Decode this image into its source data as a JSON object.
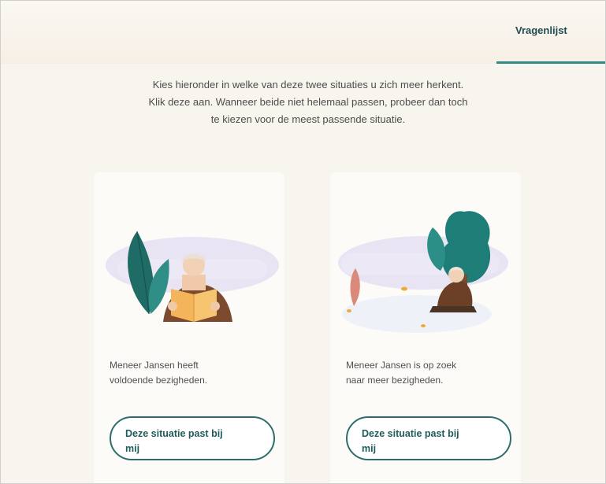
{
  "nav": {
    "active_tab": "Vragenlijst"
  },
  "intro": {
    "line1": "Kies hieronder in welke van deze twee situaties u zich meer herkent.",
    "line2": "Klik deze aan. Wanneer beide niet helemaal passen, probeer dan toch",
    "line3": "te kiezen voor de meest passende situatie."
  },
  "cards": [
    {
      "illustration": "man-reading-book",
      "text_line1": "Meneer Jansen heeft",
      "text_line2": "voldoende bezigheden.",
      "button_line1": "Deze situatie past bij",
      "button_line2": "mij"
    },
    {
      "illustration": "man-sitting-outdoors",
      "text_line1": "Meneer Jansen is op zoek",
      "text_line2": "naar meer bezigheden.",
      "button_line1": "Deze situatie past bij",
      "button_line2": "mij"
    }
  ],
  "colors": {
    "accent": "#2e8c85",
    "button_text": "#1f5c5c",
    "background": "#f8f4ee"
  }
}
